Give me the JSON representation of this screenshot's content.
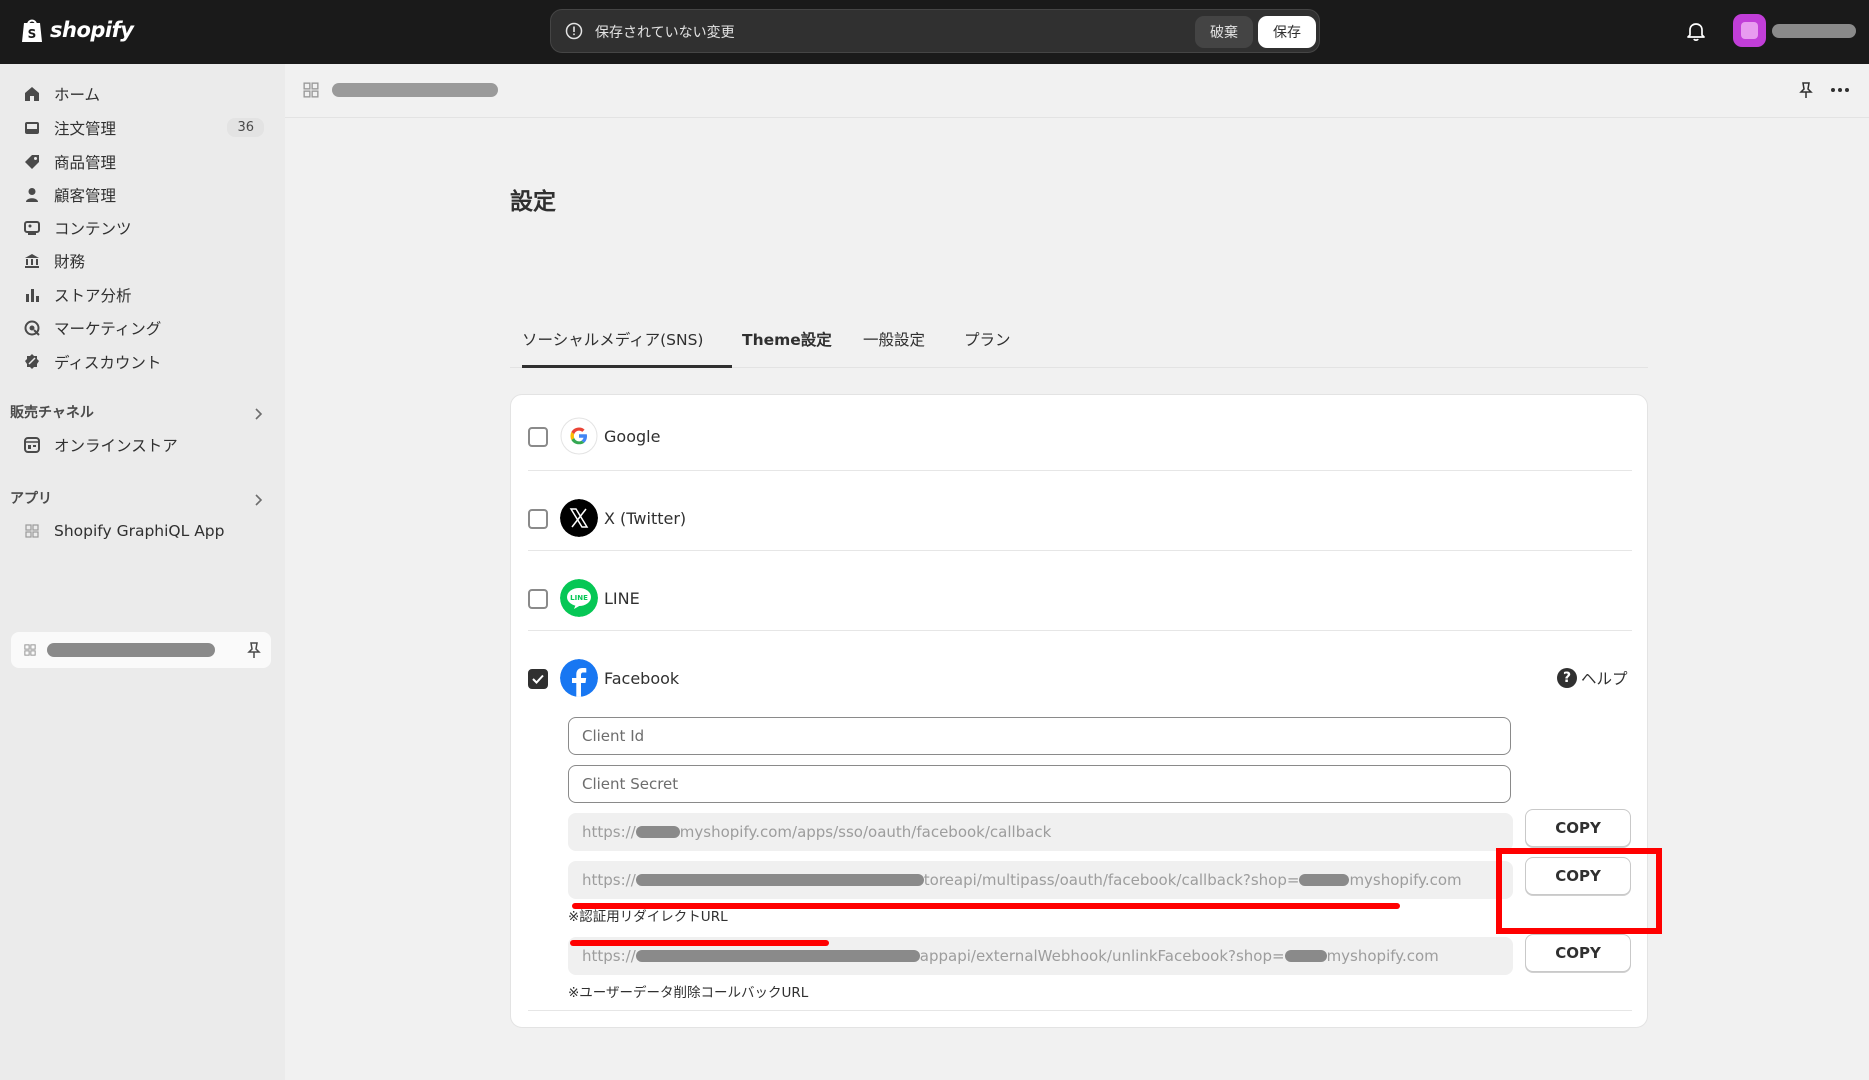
{
  "topbar": {
    "logo_text": "shopify",
    "unsaved_message": "保存されていない変更",
    "discard_label": "破棄",
    "save_label": "保存"
  },
  "sidebar": {
    "items": [
      {
        "label": "ホーム",
        "icon": "home-icon"
      },
      {
        "label": "注文管理",
        "icon": "inbox-icon",
        "badge": "36"
      },
      {
        "label": "商品管理",
        "icon": "tag-icon"
      },
      {
        "label": "顧客管理",
        "icon": "person-icon"
      },
      {
        "label": "コンテンツ",
        "icon": "image-icon"
      },
      {
        "label": "財務",
        "icon": "bank-icon"
      },
      {
        "label": "ストア分析",
        "icon": "bar-chart-icon"
      },
      {
        "label": "マーケティング",
        "icon": "target-icon"
      },
      {
        "label": "ディスカウント",
        "icon": "discount-icon"
      }
    ],
    "sales_channels_heading": "販売チャネル",
    "online_store_label": "オンラインストア",
    "apps_heading": "アプリ",
    "graphiql_label": "Shopify GraphiQL App"
  },
  "main": {
    "page_title": "設定",
    "tabs": [
      {
        "label": "ソーシャルメディア(SNS)",
        "active": true
      },
      {
        "label": "Theme設定",
        "active": false
      },
      {
        "label": "一般設定",
        "active": false
      },
      {
        "label": "プラン",
        "active": false
      }
    ],
    "providers": [
      {
        "name": "Google",
        "checked": false,
        "icon": "google-icon"
      },
      {
        "name": "X (Twitter)",
        "checked": false,
        "icon": "x-twitter-icon"
      },
      {
        "name": "LINE",
        "checked": false,
        "icon": "line-icon"
      },
      {
        "name": "Facebook",
        "checked": true,
        "icon": "facebook-icon"
      }
    ],
    "help_label": "ヘルプ",
    "client_id_placeholder": "Client Id",
    "client_secret_placeholder": "Client Secret",
    "url1_prefix": "https://",
    "url1_suffix": "myshopify.com/apps/sso/oauth/facebook/callback",
    "url2_prefix": "https://",
    "url2_mid": "toreapi/multipass/oauth/facebook/callback?shop=",
    "url2_suffix": "myshopify.com",
    "url3_prefix": "https://",
    "url3_mid": "appapi/externalWebhook/unlinkFacebook?shop=",
    "url3_suffix": "myshopify.com",
    "copy_label": "COPY",
    "redirect_note": "※認証用リダイレクトURL",
    "deletion_note": "※ユーザーデータ削除コールバックURL"
  },
  "colors": {
    "topbar_bg": "#1a1a1a",
    "annotation_red": "#ff0000",
    "facebook_blue": "#1877f2",
    "line_green": "#06c755"
  }
}
